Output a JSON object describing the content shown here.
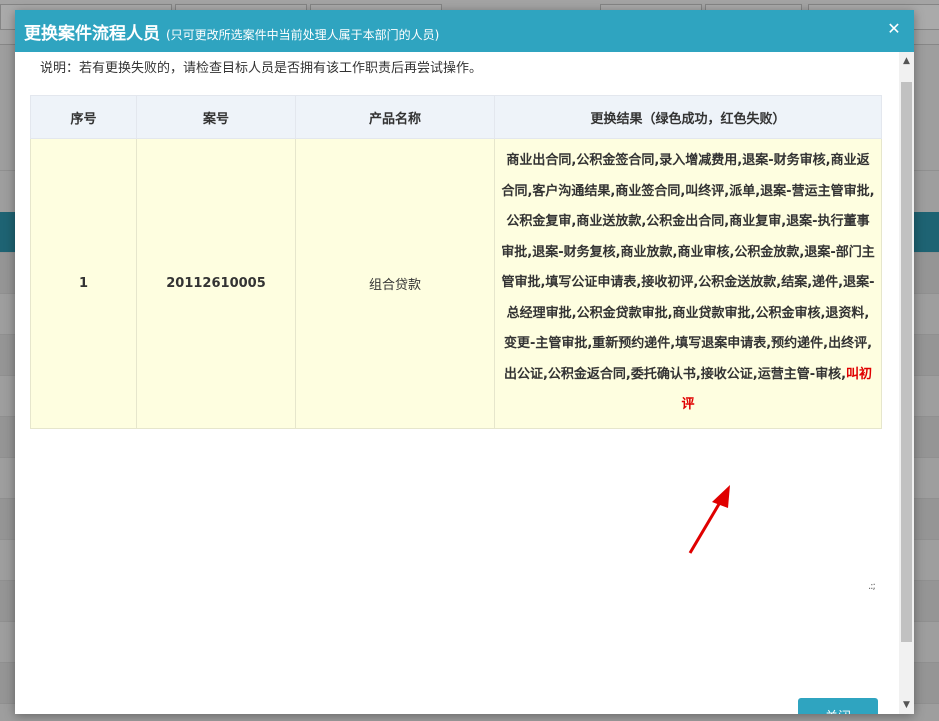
{
  "dialog": {
    "title": "更换案件流程人员",
    "subtitle": "(只可更改所选案件中当前处理人属于本部门的人员)",
    "close_glyph": "✕",
    "note": "说明：若有更换失败的，请检查目标人员是否拥有该工作职责后再尝试操作。",
    "close_button": "关闭"
  },
  "table": {
    "headers": [
      "序号",
      "案号",
      "产品名称",
      "更换结果（绿色成功，红色失败）"
    ],
    "rows": [
      {
        "index": "1",
        "case_no": "20112610005",
        "product": "组合贷款",
        "result_success": "商业出合同,公积金签合同,录入增减费用,退案-财务审核,商业返合同,客户沟通结果,商业签合同,叫终评,派单,退案-营运主管审批,公积金复审,商业送放款,公积金出合同,商业复审,退案-执行董事审批,退案-财务复核,商业放款,商业审核,公积金放款,退案-部门主管审批,填写公证申请表,接收初评,公积金送放款,结案,递件,退案-总经理审批,公积金贷款审批,商业贷款审批,公积金审核,退资料,变更-主管审批,重新预约递件,填写退案申请表,预约递件,出终评,出公证,公积金返合同,委托确认书,接收公证,运营主管-审核,",
        "result_failed": "叫初评"
      }
    ]
  },
  "colors": {
    "header_bg": "#2fa4c0",
    "success": "#0a7a0a",
    "failed": "#e00000",
    "row_bg": "#fefee0"
  },
  "icons": {
    "close": "close-icon",
    "resize": "resize-grip-icon",
    "annotation": "red-arrow-annotation"
  }
}
